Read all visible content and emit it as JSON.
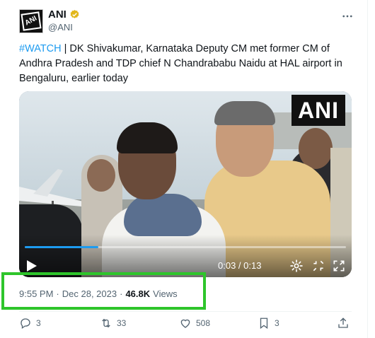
{
  "author": {
    "name": "ANI",
    "handle": "@ANI",
    "avatar_text": "ANI"
  },
  "tweet": {
    "hashtag": "#WATCH",
    "body": " | DK Shivakumar, Karnataka Deputy CM met former CM of Andhra Pradesh and TDP chief N Chandrababu Naidu at HAL airport in Bengaluru, earlier today"
  },
  "video": {
    "watermark": "ANI",
    "time": "0:03 / 0:13",
    "progress": 0.23
  },
  "meta": {
    "time": "9:55 PM",
    "separator": "·",
    "date": "Dec 28, 2023",
    "separator2": "·",
    "views_count": "46.8K",
    "views_label": "Views"
  },
  "actions": {
    "replies": "3",
    "reposts": "33",
    "likes": "508",
    "bookmarks": "3"
  },
  "colors": {
    "accent": "#1d9bf0",
    "secondary_text": "#536471",
    "highlight": "#2ec52b",
    "verified": "#e2b719"
  },
  "icons": [
    "verified-badge-icon",
    "more-icon",
    "play-icon",
    "settings-icon",
    "fullscreen-exit-icon",
    "fullscreen-icon",
    "reply-icon",
    "repost-icon",
    "like-icon",
    "bookmark-icon",
    "share-icon"
  ]
}
